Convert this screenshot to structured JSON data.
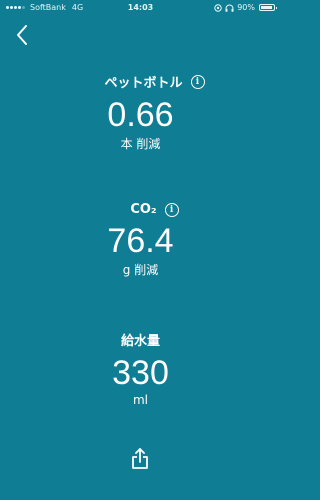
{
  "status_bar": {
    "carrier": "SoftBank",
    "network": "4G",
    "time": "14:03",
    "battery_percent": "90%",
    "battery_level": 0.9,
    "signal_bars": 4,
    "signal_total": 5,
    "icons": [
      "signal-icon",
      "location-icon",
      "headphones-icon",
      "battery-icon"
    ]
  },
  "nav": {
    "back_icon": "chevron-left-icon"
  },
  "bottle": {
    "label": "ペットボトル",
    "value": "0.66",
    "unit": "本 削減",
    "info_icon": "info-icon"
  },
  "co2": {
    "label": "CO₂",
    "value": "76.4",
    "unit": "g 削減",
    "info_icon": "info-icon"
  },
  "water": {
    "label": "給水量",
    "value": "330",
    "unit": "ml"
  },
  "footer": {
    "share_icon": "share-icon"
  },
  "colors": {
    "background": "#0f7e95",
    "text": "#ffffff"
  }
}
